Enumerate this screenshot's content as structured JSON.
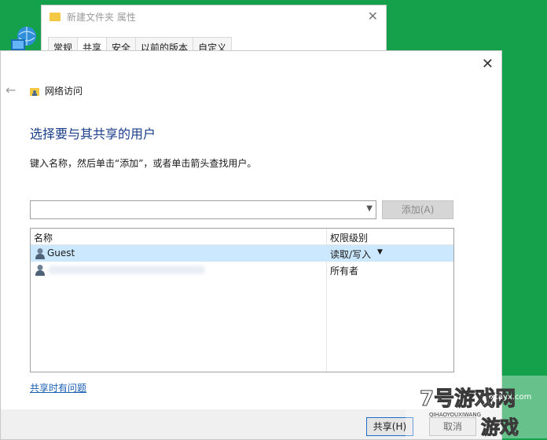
{
  "background_window": {
    "title": "新建文件夹 属性",
    "tabs": [
      "常规",
      "共享",
      "安全",
      "以前的版本",
      "自定义"
    ],
    "active_tab_index": 1
  },
  "dialog": {
    "nav_title": "网络访问",
    "heading": "选择要与其共享的用户",
    "instruction": "键入名称，然后单击“添加”，或者单击箭头查找用户。",
    "combo_value": "",
    "add_button": "添加(A)",
    "columns": {
      "name": "名称",
      "permission": "权限级别"
    },
    "rows": [
      {
        "name": "Guest",
        "permission": "读取/写入",
        "has_dropdown": true,
        "selected": true
      },
      {
        "name": "",
        "permission": "所有者",
        "has_dropdown": false,
        "selected": false
      }
    ],
    "problem_link": "共享时有问题",
    "share_button": "共享(H)",
    "cancel_button": "取消"
  },
  "watermark": {
    "brand": "7号游戏网",
    "latin": "QIHAOYOUXIWANG",
    "domain": "xtayx.com",
    "tagline": "游戏"
  },
  "colors": {
    "desktop": "#15a04c",
    "heading": "#1b3e8a",
    "link": "#1a5fb4",
    "selection": "#cce8ff"
  }
}
